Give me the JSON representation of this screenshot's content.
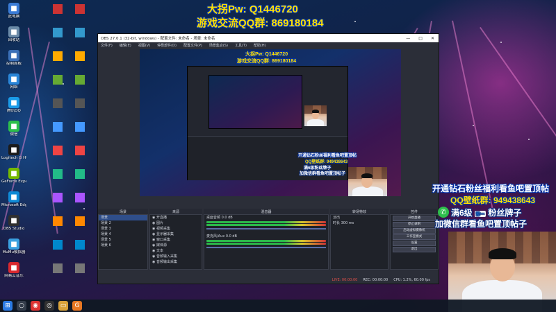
{
  "overlay": {
    "pw_line": "大拐Pw: Q1446720",
    "qq_group_line": "游戏交流QQ群: 869180184",
    "promo_line": "开通钻石粉丝福利看鱼吧置顶帖",
    "wallpaper_group": "QQ壁纸群: 949438643",
    "fan_level_prefix": "满6级",
    "fan_badge_chip": "粉一",
    "fan_level_suffix": "粉丝牌子",
    "join_line": "加微信群看鱼吧置顶帖子"
  },
  "desktop": {
    "icons": [
      {
        "label": "此电脑",
        "icon": "computer-icon",
        "color": "#3a7bd5"
      },
      {
        "label": "回收站",
        "icon": "recycle-bin-icon",
        "color": "#6b8ba8"
      },
      {
        "label": "控制面板",
        "icon": "control-panel-icon",
        "color": "#3b6fb6"
      },
      {
        "label": "网络",
        "icon": "network-icon",
        "color": "#2a86d8"
      },
      {
        "label": "腾讯QQ",
        "icon": "qq-icon",
        "color": "#1a9be8"
      },
      {
        "label": "微信",
        "icon": "wechat-icon",
        "color": "#2dbe4b"
      },
      {
        "label": "Logitech G HUB",
        "icon": "logitech-icon",
        "color": "#1c1c1c"
      },
      {
        "label": "GeForce Experience",
        "icon": "geforce-icon",
        "color": "#76b900"
      },
      {
        "label": "Microsoft Edge",
        "icon": "edge-icon",
        "color": "#0f8ad6"
      },
      {
        "label": "OBS Studio",
        "icon": "obs-icon",
        "color": "#303030"
      },
      {
        "label": "MuMu模拟器",
        "icon": "mumu-icon",
        "color": "#3aa0e0"
      },
      {
        "label": "网易云音乐",
        "icon": "netease-music-icon",
        "color": "#d8282f"
      }
    ]
  },
  "obs": {
    "title": "OBS 27.0.1 (32-bit, windows) - 配置文件: 未命名 - 场景: 未命名",
    "menu": [
      "文件(F)",
      "编辑(E)",
      "视图(V)",
      "停靠部件(D)",
      "配置文件(P)",
      "场景集合(S)",
      "工具(T)",
      "帮助(H)"
    ],
    "window_controls": [
      "—",
      "□",
      "✕"
    ],
    "docks": {
      "scenes_header": "场景",
      "sources_header": "来源",
      "mixer_header": "混音器",
      "transitions_header": "转场特效",
      "controls_header": "控件"
    },
    "scenes": [
      "场景",
      "场景 2",
      "场景 3",
      "场景 4",
      "场景 5",
      "场景 6"
    ],
    "sources": [
      "开直播",
      "图片",
      "视频采集",
      "显示器采集",
      "窗口采集",
      "媒体源",
      "文本",
      "音频输入采集",
      "音频输出采集"
    ],
    "mixer_tracks": [
      {
        "name": "桌面音频",
        "db": "0.0 dB"
      },
      {
        "name": "麦克风/Aux",
        "db": "0.0 dB"
      }
    ],
    "transition": {
      "type": "淡出",
      "duration_label": "时长",
      "duration": "300 ms"
    },
    "controls": [
      "开始直播",
      "停止录制",
      "启动虚拟摄像机",
      "工作室模式",
      "设置",
      "退出"
    ],
    "status": {
      "live": "LIVE: 00:00:00",
      "rec": "REC: 00:00:00",
      "cpu": "CPU: 1.2%, 60.00 fps"
    }
  },
  "taskbar": {
    "icons": [
      {
        "icon": "start-icon",
        "color": "#2b7be4",
        "glyph": "⊞"
      },
      {
        "icon": "search-icon",
        "color": "#333c4a",
        "glyph": "○"
      },
      {
        "icon": "chrome-icon",
        "color": "#d33",
        "glyph": "◉"
      },
      {
        "icon": "obs-taskbar-icon",
        "color": "#303030",
        "glyph": "◎"
      },
      {
        "icon": "folder-icon",
        "color": "#d8a23a",
        "glyph": "▭"
      },
      {
        "icon": "game-icon",
        "color": "#e87722",
        "glyph": "G"
      }
    ]
  },
  "colors": {
    "overlay_yellow": "#ffe000",
    "obs_dark": "#2b2e38",
    "live_red": "#e0504a"
  }
}
